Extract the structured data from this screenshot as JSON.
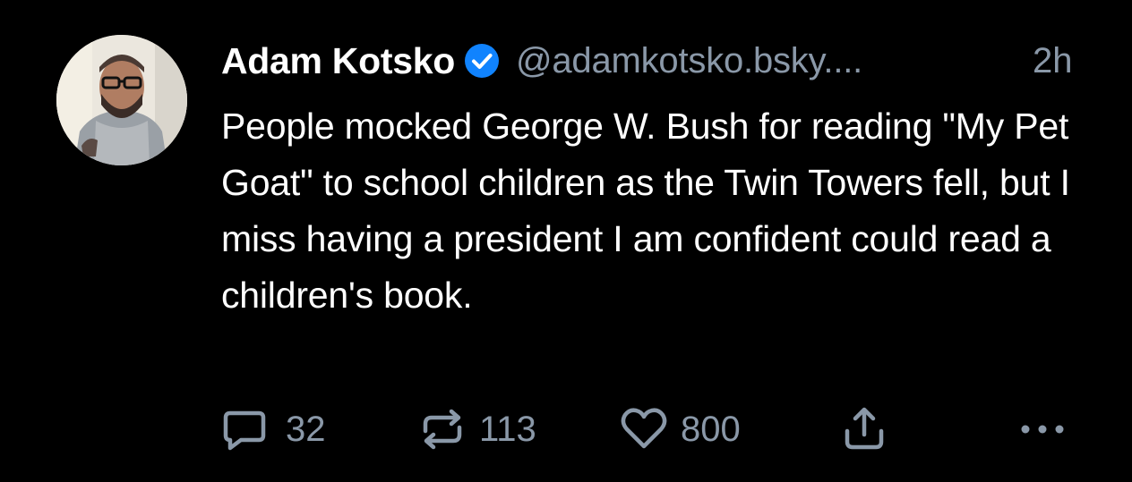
{
  "author": {
    "display_name": "Adam Kotsko",
    "handle": "@adamkotsko.bsky....",
    "verified": true,
    "avatar_icon": "avatar-icon"
  },
  "post": {
    "time": "2h",
    "text": "People mocked George W. Bush for reading \"My Pet Goat\" to school children as the Twin Towers fell, but I miss having a president I am confident could read a children's book."
  },
  "actions": {
    "reply_count": "32",
    "repost_count": "113",
    "like_count": "800",
    "reply_icon": "reply-icon",
    "repost_icon": "repost-icon",
    "like_icon": "heart-icon",
    "share_icon": "share-icon",
    "more_icon": "more-icon"
  },
  "colors": {
    "background": "#000000",
    "text": "#ffffff",
    "muted": "#8a98a8",
    "verified_badge": "#1083fe"
  }
}
